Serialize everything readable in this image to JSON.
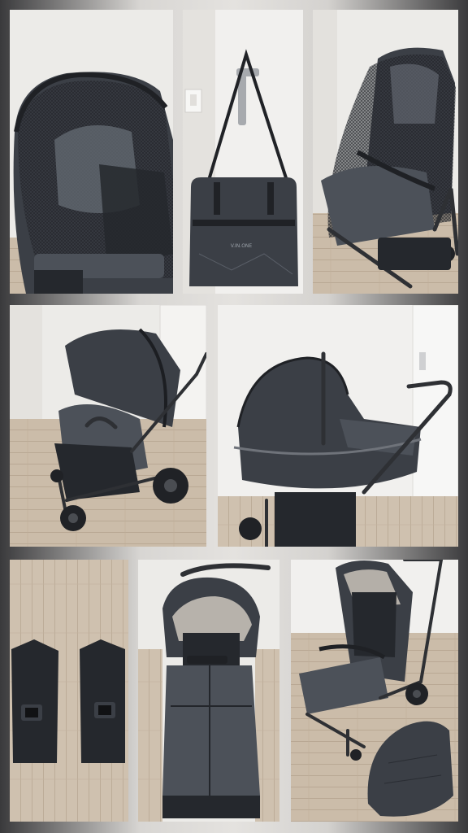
{
  "collage": {
    "background_color": "#d9d7d4",
    "tiles": [
      {
        "subject": "canopy-with-mosquito-net"
      },
      {
        "subject": "changing-bag-on-door",
        "bag_label": "V.IN.ONE"
      },
      {
        "subject": "seat-with-mosquito-net"
      },
      {
        "subject": "stroller-seat-unit"
      },
      {
        "subject": "stroller-carrycot"
      },
      {
        "subject": "car-seat-adapters"
      },
      {
        "subject": "stroller-with-footmuff"
      },
      {
        "subject": "stroller-seat-and-liner"
      }
    ]
  },
  "colors": {
    "fabric": "#3b3f46",
    "frame": "#2e3034",
    "wall": "#ecebe8",
    "floor": "#cdbfae"
  }
}
